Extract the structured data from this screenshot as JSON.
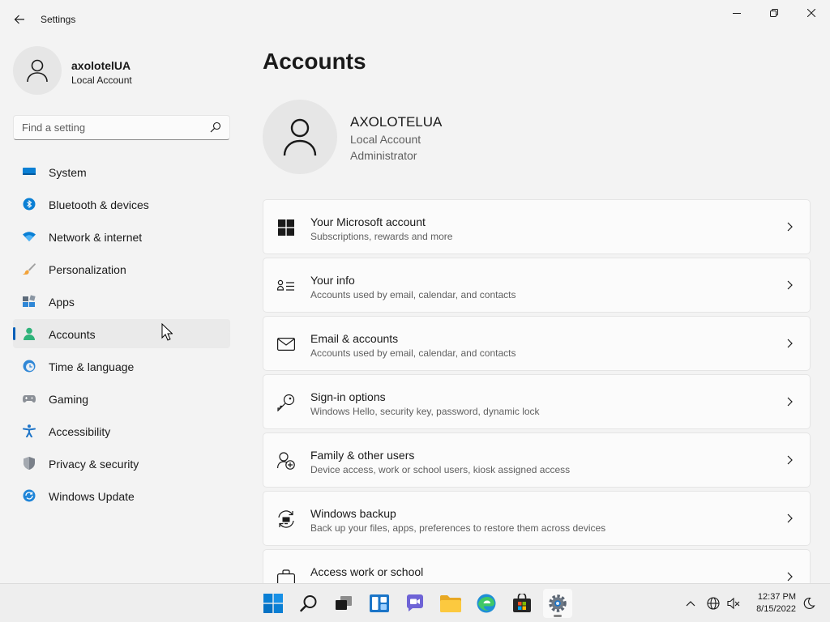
{
  "window": {
    "title": "Settings"
  },
  "profile": {
    "name": "axolotelUA",
    "type": "Local Account"
  },
  "search": {
    "placeholder": "Find a setting"
  },
  "nav": [
    {
      "label": "System",
      "icon": "monitor-icon"
    },
    {
      "label": "Bluetooth & devices",
      "icon": "bluetooth-icon"
    },
    {
      "label": "Network & internet",
      "icon": "wifi-icon"
    },
    {
      "label": "Personalization",
      "icon": "brush-icon"
    },
    {
      "label": "Apps",
      "icon": "apps-icon"
    },
    {
      "label": "Accounts",
      "icon": "person-icon",
      "selected": true
    },
    {
      "label": "Time & language",
      "icon": "globe-clock-icon"
    },
    {
      "label": "Gaming",
      "icon": "gamepad-icon"
    },
    {
      "label": "Accessibility",
      "icon": "accessibility-icon"
    },
    {
      "label": "Privacy & security",
      "icon": "shield-icon"
    },
    {
      "label": "Windows Update",
      "icon": "update-icon"
    }
  ],
  "main": {
    "title": "Accounts",
    "account": {
      "name": "AXOLOTELUA",
      "line1": "Local Account",
      "line2": "Administrator"
    },
    "cards": [
      {
        "title": "Your Microsoft account",
        "subtitle": "Subscriptions, rewards and more",
        "icon": "windows-logo-icon"
      },
      {
        "title": "Your info",
        "subtitle": "Accounts used by email, calendar, and contacts",
        "icon": "person-card-icon"
      },
      {
        "title": "Email & accounts",
        "subtitle": "Accounts used by email, calendar, and contacts",
        "icon": "mail-icon"
      },
      {
        "title": "Sign-in options",
        "subtitle": "Windows Hello, security key, password, dynamic lock",
        "icon": "key-icon"
      },
      {
        "title": "Family & other users",
        "subtitle": "Device access, work or school users, kiosk assigned access",
        "icon": "person-add-icon"
      },
      {
        "title": "Windows backup",
        "subtitle": "Back up your files, apps, preferences to restore them across devices",
        "icon": "backup-icon"
      },
      {
        "title": "Access work or school",
        "subtitle": "",
        "icon": "briefcase-icon"
      }
    ]
  },
  "taskbar": {
    "apps": [
      "start-icon",
      "search-icon",
      "task-view-icon",
      "widgets-icon",
      "chat-icon",
      "file-explorer-icon",
      "edge-icon",
      "store-icon",
      "settings-icon"
    ],
    "time": "12:37 PM",
    "date": "8/15/2022"
  },
  "colors": {
    "accent": "#005fb8",
    "background": "#f3f3f3",
    "card": "#fbfbfb"
  }
}
